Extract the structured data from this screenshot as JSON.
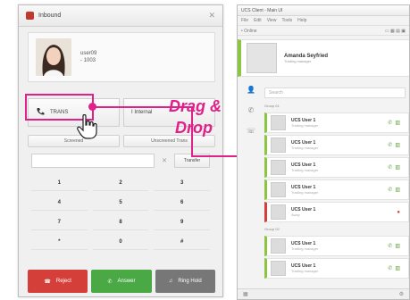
{
  "dialog": {
    "title": "Inbound",
    "caller_name": "user09",
    "caller_ext": "- 1003",
    "transfer_label": "TRANS",
    "internal_label": "I Internal",
    "btn_screened": "Screened",
    "btn_unscreened": "Unscreened Trans",
    "transfer_button": "Transfer",
    "keys": [
      "1",
      "2",
      "3",
      "4",
      "5",
      "6",
      "7",
      "8",
      "9",
      "*",
      "0",
      "#"
    ],
    "reject": "Reject",
    "answer": "Answer",
    "ring": "Ring Hold"
  },
  "annotation": {
    "line1": "Drag &",
    "line2": "Drop",
    "color": "#e0218a"
  },
  "panel": {
    "title": "UCS Client - Main UI",
    "menu": [
      "File",
      "Edit",
      "View",
      "Tools",
      "Help"
    ],
    "status": "• Online",
    "my_name": "Amanda Seyfried",
    "my_sub": "Trading manager",
    "search_placeholder": "Search",
    "group1": "Group 01",
    "group2": "Group 02",
    "users": [
      {
        "name": "UCS User 1",
        "sub": "Trading manager"
      },
      {
        "name": "UCS User 1",
        "sub": "Trading manager"
      },
      {
        "name": "UCS User 1",
        "sub": "Trading manager"
      },
      {
        "name": "UCS User 1",
        "sub": "Trading manager"
      },
      {
        "name": "UCS User 1",
        "sub": "Away"
      },
      {
        "name": "UCS User 1",
        "sub": "Trading manager"
      },
      {
        "name": "UCS User 1",
        "sub": "Trading manager"
      }
    ]
  }
}
